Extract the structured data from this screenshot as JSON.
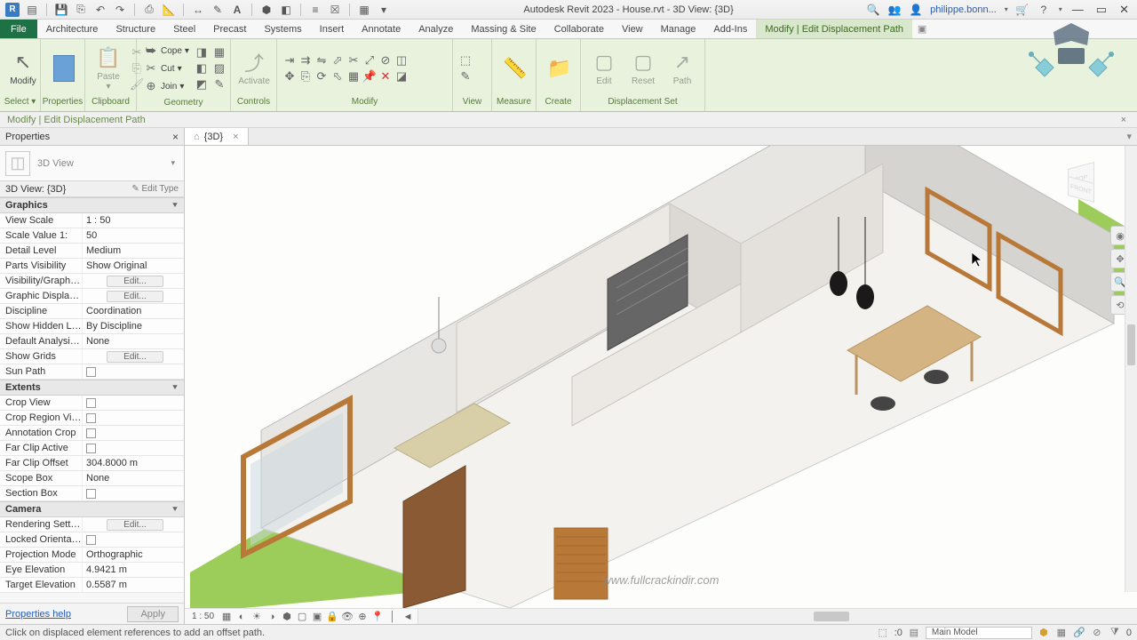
{
  "titlebar": {
    "title": "Autodesk Revit 2023 - House.rvt - 3D View: {3D}",
    "user": "philippe.bonn..."
  },
  "ribbon_tabs": [
    "Architecture",
    "Structure",
    "Steel",
    "Precast",
    "Systems",
    "Insert",
    "Annotate",
    "Analyze",
    "Massing & Site",
    "Collaborate",
    "View",
    "Manage",
    "Add-Ins"
  ],
  "file_tab": "File",
  "context_tab": "Modify | Edit Displacement Path",
  "ribbon_groups": {
    "select": "Select",
    "properties": "Properties",
    "clipboard": "Clipboard",
    "geometry": "Geometry",
    "controls": "Controls",
    "modify": "Modify",
    "view": "View",
    "measure": "Measure",
    "create": "Create",
    "displacement": "Displacement Set"
  },
  "ribbon_btns": {
    "modify": "Modify",
    "paste": "Paste",
    "cope": "Cope",
    "cut": "Cut",
    "join": "Join",
    "activate": "Activate",
    "edit": "Edit",
    "reset": "Reset",
    "path": "Path"
  },
  "infobar": "Modify | Edit Displacement Path",
  "properties": {
    "title": "Properties",
    "type": "3D View",
    "instance": "3D View: {3D}",
    "edit_type": "Edit Type",
    "sections": {
      "graphics": "Graphics",
      "extents": "Extents",
      "camera": "Camera"
    },
    "rows": {
      "view_scale": {
        "k": "View Scale",
        "v": "1 : 50"
      },
      "scale_value": {
        "k": "Scale Value    1:",
        "v": "50"
      },
      "detail_level": {
        "k": "Detail Level",
        "v": "Medium"
      },
      "parts_vis": {
        "k": "Parts Visibility",
        "v": "Show Original"
      },
      "vis_graphics": {
        "k": "Visibility/Graphic...",
        "v": "Edit..."
      },
      "graphic_display": {
        "k": "Graphic Display ...",
        "v": "Edit..."
      },
      "discipline": {
        "k": "Discipline",
        "v": "Coordination"
      },
      "show_hidden": {
        "k": "Show Hidden Lin...",
        "v": "By Discipline"
      },
      "default_analysis": {
        "k": "Default Analysis ...",
        "v": "None"
      },
      "show_grids": {
        "k": "Show Grids",
        "v": "Edit..."
      },
      "sun_path": {
        "k": "Sun Path",
        "v": ""
      },
      "crop_view": {
        "k": "Crop View",
        "v": ""
      },
      "crop_region": {
        "k": "Crop Region Visi...",
        "v": ""
      },
      "annotation_crop": {
        "k": "Annotation Crop",
        "v": ""
      },
      "far_clip_active": {
        "k": "Far Clip Active",
        "v": ""
      },
      "far_clip_offset": {
        "k": "Far Clip Offset",
        "v": "304.8000 m"
      },
      "scope_box": {
        "k": "Scope Box",
        "v": "None"
      },
      "section_box": {
        "k": "Section Box",
        "v": ""
      },
      "rendering": {
        "k": "Rendering Settings",
        "v": "Edit..."
      },
      "locked_orient": {
        "k": "Locked Orientati...",
        "v": ""
      },
      "projection": {
        "k": "Projection Mode",
        "v": "Orthographic"
      },
      "eye_elev": {
        "k": "Eye Elevation",
        "v": "4.9421 m"
      },
      "target_elev": {
        "k": "Target Elevation",
        "v": "0.5587 m"
      }
    },
    "help": "Properties help",
    "apply": "Apply"
  },
  "view": {
    "tab_name": "{3D}",
    "scale": "1 : 50"
  },
  "statusbar": {
    "hint": "Click on displaced element references to add an offset path.",
    "model": "Main Model",
    "sel_count": ":0"
  },
  "watermark": "www.fullcrackindir.com"
}
